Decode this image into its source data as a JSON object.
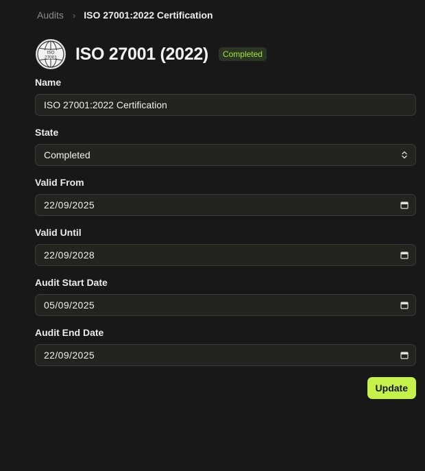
{
  "breadcrumb": {
    "parent": "Audits",
    "separator": "›",
    "current": "ISO 27001:2022 Certification"
  },
  "header": {
    "logo_line1": "ISO",
    "logo_line2": "27001",
    "logo_icon": "iso-globe-icon",
    "title": "ISO 27001 (2022)",
    "badge": "Completed"
  },
  "form": {
    "name": {
      "label": "Name",
      "value": "ISO 27001:2022 Certification"
    },
    "state": {
      "label": "State",
      "value": "Completed",
      "icon": "chevron-up-down-icon"
    },
    "valid_from": {
      "label": "Valid From",
      "value": "22/09/2025",
      "icon": "calendar-icon"
    },
    "valid_until": {
      "label": "Valid Until",
      "value": "22/09/2028",
      "icon": "calendar-icon"
    },
    "audit_start": {
      "label": "Audit Start Date",
      "value": "05/09/2025",
      "icon": "calendar-icon"
    },
    "audit_end": {
      "label": "Audit End Date",
      "value": "22/09/2025",
      "icon": "calendar-icon"
    }
  },
  "actions": {
    "update_label": "Update"
  },
  "colors": {
    "background": "#181818",
    "input_background": "#22241f",
    "input_border": "#3a3d36",
    "accent": "#c4f24b",
    "badge_background": "#2a3524",
    "badge_text": "#a6e23a"
  }
}
